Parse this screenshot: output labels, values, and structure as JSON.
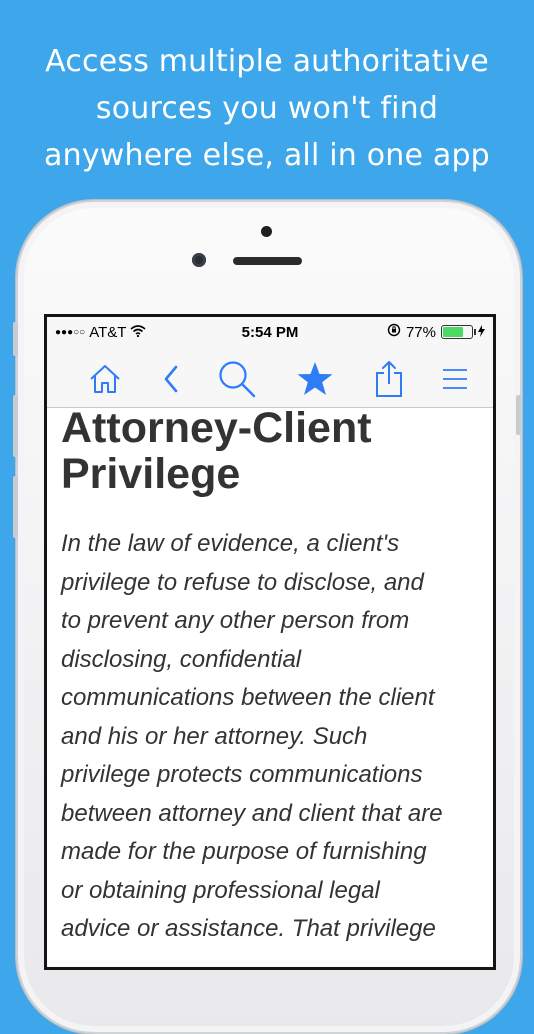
{
  "headline": {
    "lines": [
      "Access multiple authoritative",
      "sources you won't find",
      "anywhere else, all in one app"
    ]
  },
  "status_bar": {
    "signal": "●●●○○",
    "carrier": "AT&T",
    "time": "5:54 PM",
    "battery_percent": "77%",
    "battery_level": 0.77,
    "icons": [
      "wifi-icon",
      "rotation-lock-icon",
      "battery-icon",
      "charging-icon"
    ]
  },
  "toolbar": {
    "icons": [
      "home-icon",
      "back-chevron-icon",
      "search-icon",
      "favorite-star-icon",
      "share-icon",
      "menu-icon"
    ],
    "accent": "#2f7cf6"
  },
  "article": {
    "title_line1": "Attorney-Client",
    "title_line2": "Privilege",
    "body_lines": [
      "In the law of evidence, a client's",
      "privilege to refuse to disclose, and",
      "to prevent any other person from",
      "disclosing, confidential",
      "communications between the client",
      "and his or her attorney. Such",
      "privilege protects communications",
      "between attorney and client that are",
      "made for the purpose of furnishing",
      "or obtaining professional legal",
      "advice or assistance. That privilege"
    ]
  },
  "colors": {
    "background": "#3ea6ea",
    "text": "#333333"
  }
}
